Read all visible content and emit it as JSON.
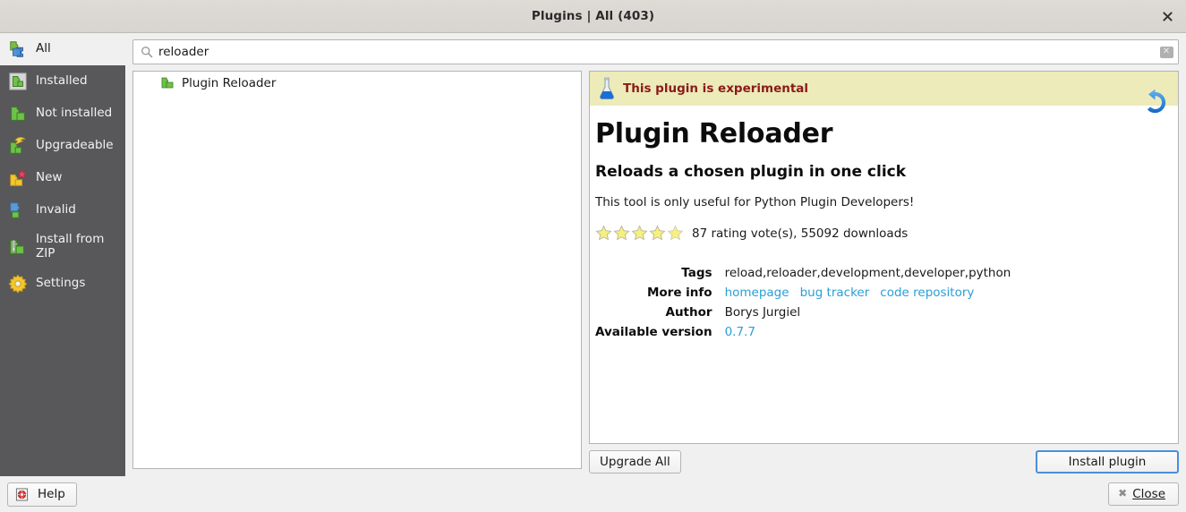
{
  "window": {
    "title": "Plugins | All (403)",
    "close_glyph": "close-icon"
  },
  "sidebar": {
    "items": [
      {
        "label": "All",
        "icon": "puzzle-all-icon",
        "selected": true
      },
      {
        "label": "Installed",
        "icon": "puzzle-installed-icon",
        "selected": false
      },
      {
        "label": "Not installed",
        "icon": "puzzle-not-installed-icon",
        "selected": false
      },
      {
        "label": "Upgradeable",
        "icon": "puzzle-upgradeable-icon",
        "selected": false
      },
      {
        "label": "New",
        "icon": "puzzle-new-icon",
        "selected": false
      },
      {
        "label": "Invalid",
        "icon": "puzzle-invalid-icon",
        "selected": false
      },
      {
        "label": "Install from ZIP",
        "icon": "puzzle-zip-icon",
        "selected": false
      },
      {
        "label": "Settings",
        "icon": "gear-icon",
        "selected": false
      }
    ]
  },
  "search": {
    "value": "reloader",
    "placeholder": "Search...",
    "icon": "search-icon",
    "clear_icon": "clear-icon"
  },
  "plugin_list": {
    "rows": [
      {
        "name": "Plugin Reloader",
        "icon": "puzzle-green-icon"
      }
    ]
  },
  "detail": {
    "experimental_notice": "This plugin is experimental",
    "experimental_icon": "flask-icon",
    "reload_icon": "reload-icon",
    "title": "Plugin Reloader",
    "about": "Reloads a chosen plugin in one click",
    "description": "This tool is only useful for Python Plugin Developers!",
    "rating": {
      "stars": 5,
      "text": "87 rating vote(s), 55092 downloads",
      "votes": 87,
      "downloads": 55092
    },
    "meta": [
      {
        "key": "Tags",
        "type": "text",
        "value": "reload,reloader,development,developer,python"
      },
      {
        "key": "More info",
        "type": "links",
        "links": [
          "homepage",
          "bug tracker",
          "code repository"
        ]
      },
      {
        "key": "Author",
        "type": "text",
        "value": "Borys Jurgiel"
      },
      {
        "key": "Available version",
        "type": "link",
        "value": "0.7.7"
      }
    ]
  },
  "buttons": {
    "upgrade_all": "Upgrade All",
    "install_plugin": "Install plugin",
    "help": "Help",
    "help_icon": "help-icon",
    "close": "Close",
    "close_icon": "close-x-icon"
  },
  "colors": {
    "sidebar_bg": "#58585a",
    "sidebar_selected_bg": "#f0f0f0",
    "experimental_bg": "#ecebb9",
    "experimental_fg": "#8b1a1a",
    "link": "#2a9fd6",
    "primary_border": "#4a90d9",
    "star": "#f5e96b",
    "window_bg": "#f0f0f0"
  }
}
